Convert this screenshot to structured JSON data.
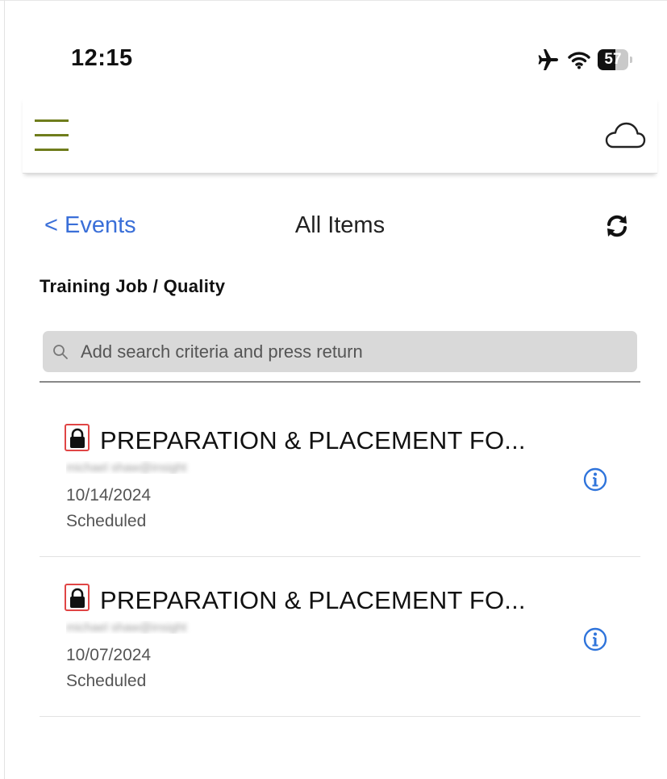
{
  "status_bar": {
    "time": "12:15",
    "battery_level": "57",
    "battery_fraction": 0.57,
    "icons": [
      "airplane-icon",
      "wifi-icon",
      "battery-icon"
    ]
  },
  "toolbar": {
    "menu_icon": "hamburger-menu-icon",
    "cloud_icon": "cloud-icon",
    "accent_color": "#6f7d1c"
  },
  "nav": {
    "back_label": "< Events",
    "title": "All Items",
    "refresh_icon": "refresh-icon",
    "link_color": "#3a6fd8"
  },
  "section": {
    "title": "Training Job / Quality"
  },
  "search": {
    "placeholder": "Add search criteria and press return",
    "value": ""
  },
  "items": [
    {
      "title": "PREPARATION & PLACEMENT FO...",
      "owner": "michael shaw@insight",
      "date": "10/14/2024",
      "status": "Scheduled",
      "locked": true
    },
    {
      "title": "PREPARATION & PLACEMENT FO...",
      "owner": "michael shaw@insight",
      "date": "10/07/2024",
      "status": "Scheduled",
      "locked": true
    }
  ]
}
